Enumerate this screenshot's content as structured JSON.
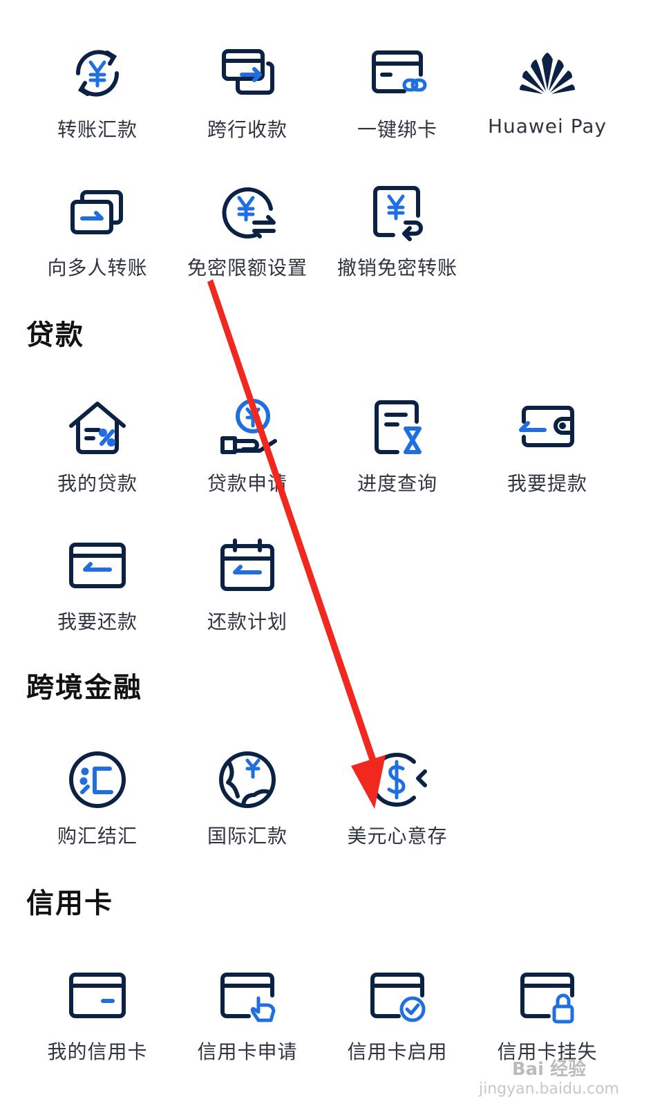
{
  "colors": {
    "navy": "#0b2245",
    "blue": "#1f6fe0",
    "text": "#2f3440",
    "title": "#111111",
    "arrow": "#f0281e"
  },
  "transfer_section": {
    "items": [
      {
        "label": "转账汇款",
        "icon": "yuan-transfer-icon"
      },
      {
        "label": "跨行收款",
        "icon": "interbank-receive-icon"
      },
      {
        "label": "一键绑卡",
        "icon": "bind-card-icon"
      },
      {
        "label": "Huawei Pay",
        "icon": "huawei-logo-icon"
      },
      {
        "label": "向多人转账",
        "icon": "multi-transfer-icon"
      },
      {
        "label": "免密限额设置",
        "icon": "limit-setting-icon"
      },
      {
        "label": "撤销免密转账",
        "icon": "revoke-transfer-icon"
      }
    ]
  },
  "loan_section": {
    "title": "贷款",
    "items": [
      {
        "label": "我的贷款",
        "icon": "house-loan-icon"
      },
      {
        "label": "贷款申请",
        "icon": "loan-apply-icon"
      },
      {
        "label": "进度查询",
        "icon": "progress-query-icon"
      },
      {
        "label": "我要提款",
        "icon": "withdraw-wallet-icon"
      },
      {
        "label": "我要还款",
        "icon": "repay-card-icon"
      },
      {
        "label": "还款计划",
        "icon": "repay-calendar-icon"
      }
    ]
  },
  "crossborder_section": {
    "title": "跨境金融",
    "items": [
      {
        "label": "购汇结汇",
        "icon": "exchange-icon"
      },
      {
        "label": "国际汇款",
        "icon": "globe-remit-icon"
      },
      {
        "label": "美元心意存",
        "icon": "dollar-deposit-icon"
      }
    ]
  },
  "credit_section": {
    "title": "信用卡",
    "items": [
      {
        "label": "我的信用卡",
        "icon": "credit-card-icon"
      },
      {
        "label": "信用卡申请",
        "icon": "card-apply-icon"
      },
      {
        "label": "信用卡启用",
        "icon": "card-activate-icon"
      },
      {
        "label": "信用卡挂失",
        "icon": "card-lock-icon"
      }
    ]
  },
  "watermark": {
    "brand": "Bai 经验",
    "url": "jingyan.baidu.com"
  }
}
